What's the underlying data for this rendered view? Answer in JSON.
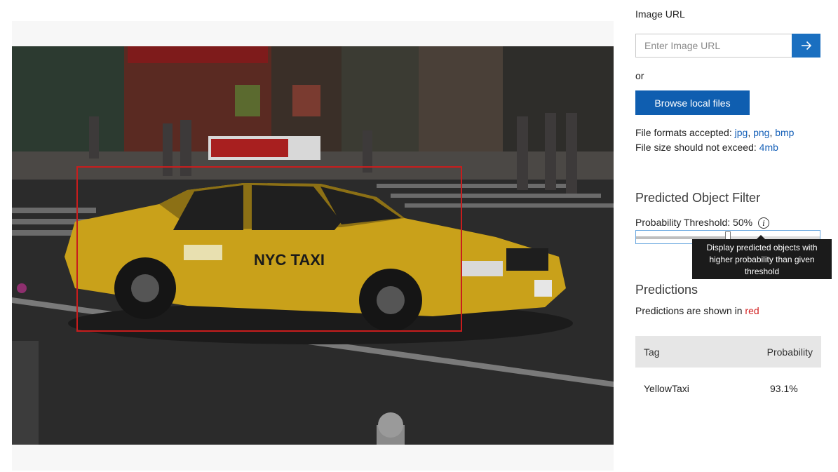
{
  "image_url": {
    "label": "Image URL",
    "placeholder": "Enter Image URL",
    "value": "",
    "submit_icon": "arrow-right-icon"
  },
  "or_text": "or",
  "browse_button": "Browse local files",
  "file_formats": {
    "prefix": "File formats accepted: ",
    "formats": [
      "jpg",
      "png",
      "bmp"
    ],
    "separator": ", "
  },
  "file_size": {
    "prefix": "File size should not exceed: ",
    "limit": "4mb"
  },
  "filter": {
    "heading": "Predicted Object Filter",
    "threshold_label": "Probability Threshold: 50%",
    "threshold_value": 0.5,
    "info_icon": "info-icon",
    "tooltip": "Display predicted objects with higher probability than given threshold"
  },
  "predictions": {
    "heading": "Predictions",
    "note_prefix": "Predictions are shown in ",
    "note_color_word": "red",
    "box_color": "#c81d1d",
    "columns": [
      "Tag",
      "Probability"
    ],
    "rows": [
      {
        "tag": "YellowTaxi",
        "probability": "93.1%"
      }
    ]
  },
  "colors": {
    "accent": "#1a6fc0",
    "button": "#0f5eb0",
    "link": "#1560b8",
    "prediction_red": "#d21f1f"
  }
}
